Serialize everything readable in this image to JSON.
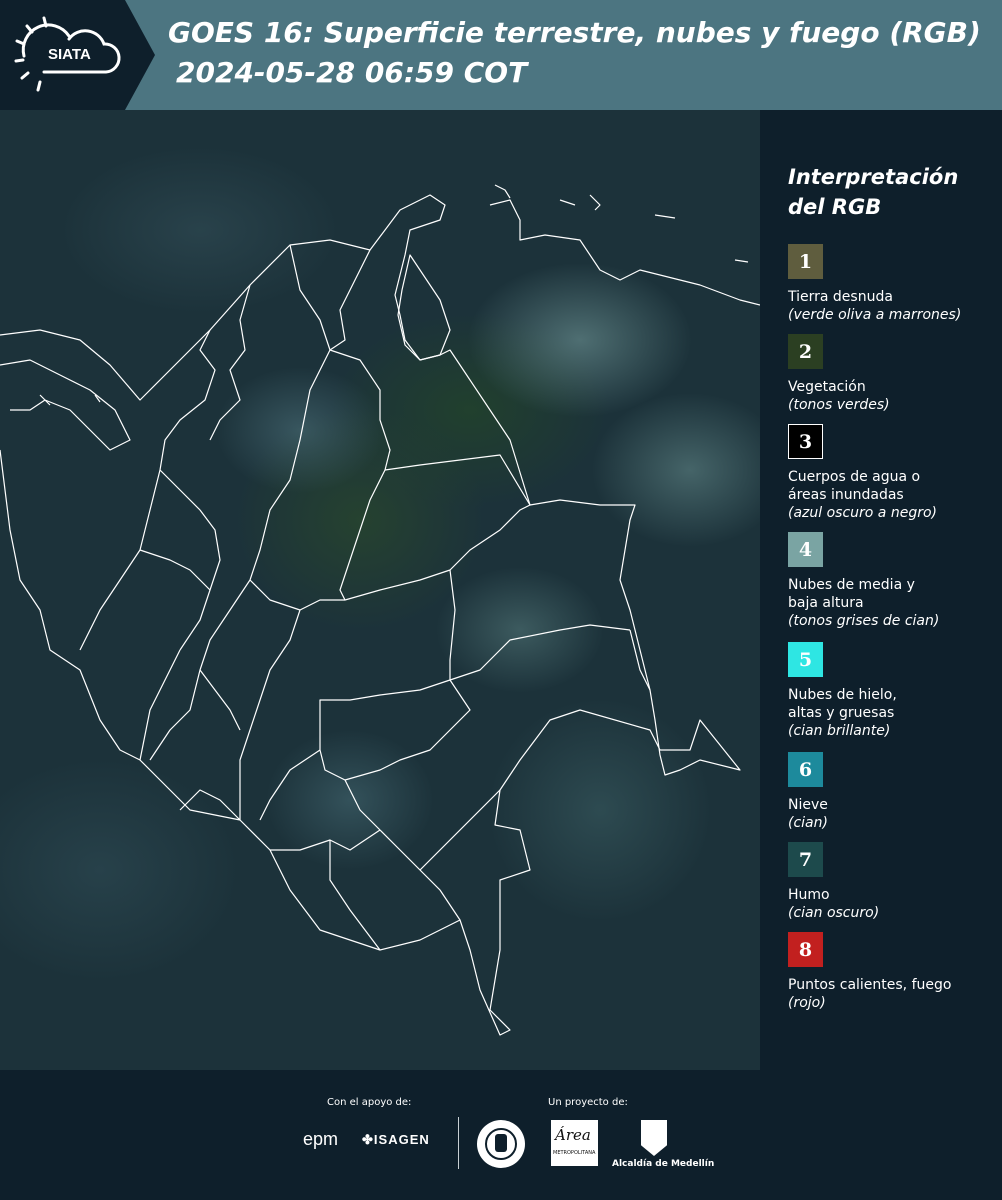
{
  "header": {
    "logo_text": "SIATA",
    "title_line1": "GOES 16: Superficie terrestre, nubes y fuego (RGB)",
    "title_line2": "2024-05-28 06:59 COT"
  },
  "legend": {
    "title_line1": "Interpretación",
    "title_line2": "del RGB",
    "items": [
      {
        "number": "1",
        "color": "#5f5d3e",
        "label": "Tierra desnuda",
        "sub": "(verde oliva a marrones)"
      },
      {
        "number": "2",
        "color": "#2b3f22",
        "label": "Vegetación",
        "sub": "(tonos verdes)"
      },
      {
        "number": "3",
        "color": "#000000",
        "label": "Cuerpos de agua o áreas inundadas",
        "sub": "(azul oscuro a negro)"
      },
      {
        "number": "4",
        "color": "#7aa4a3",
        "label": "Nubes de media y baja altura",
        "sub": "(tonos grises de cian)"
      },
      {
        "number": "5",
        "color": "#2ee6e3",
        "label": "Nubes de hielo, altas y gruesas",
        "sub": "(cian brillante)"
      },
      {
        "number": "6",
        "color": "#1d8a9c",
        "label": "Nieve",
        "sub": "(cian)"
      },
      {
        "number": "7",
        "color": "#1d4a4c",
        "label": "Humo",
        "sub": "(cian oscuro)"
      },
      {
        "number": "8",
        "color": "#c2201f",
        "label": "Puntos calientes, fuego",
        "sub": "(rojo)"
      }
    ]
  },
  "footer": {
    "support_label": "Con el apoyo de:",
    "project_label": "Un proyecto de:",
    "epm": "epm",
    "isagen": "ISAGEN",
    "area_logo_text": "Área",
    "area_sub": "METROPOLITANA",
    "alcaldia": "Alcaldía de Medellín"
  }
}
